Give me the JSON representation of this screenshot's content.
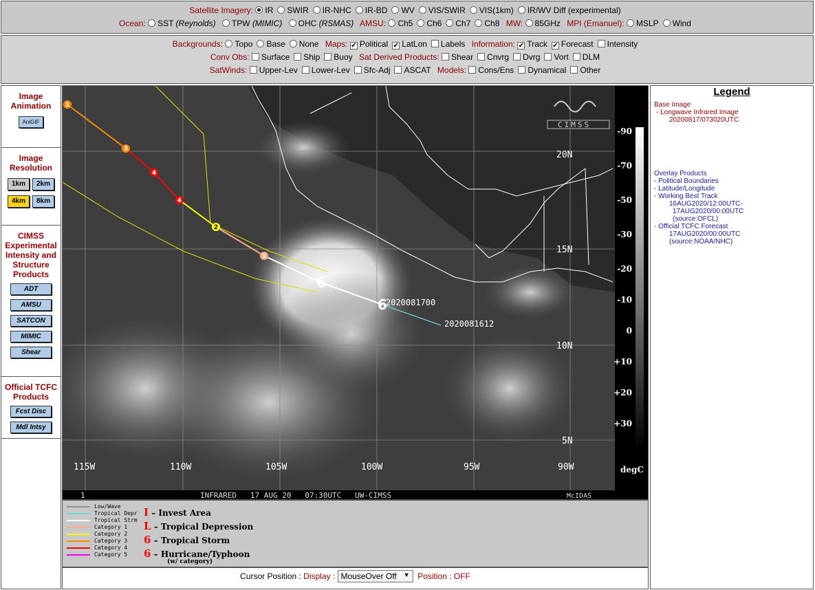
{
  "top1": {
    "row1_label": "Satellite Imagery:",
    "row1_options": [
      {
        "label": "IR",
        "checked": true
      },
      {
        "label": "SWIR",
        "checked": false
      },
      {
        "label": "IR-NHC",
        "checked": false
      },
      {
        "label": "IR-BD",
        "checked": false
      },
      {
        "label": "WV",
        "checked": false
      },
      {
        "label": "VIS/SWIR",
        "checked": false
      },
      {
        "label": "VIS(1km)",
        "checked": false
      },
      {
        "label": "IR/WV Diff (experimental)",
        "checked": false
      }
    ],
    "ocean_label": "Ocean:",
    "sst": "SST",
    "sst_src": "(Reynolds)",
    "tpw": "TPW",
    "tpw_src": "(MIMIC)",
    "ohc": "OHC",
    "ohc_src": "(RSMAS)",
    "amsu_label": "AMSU:",
    "amsu_opts": [
      "Ch5",
      "Ch6",
      "Ch7",
      "Ch8"
    ],
    "mw_label": "MW:",
    "mw_opt": "85GHz",
    "mpi_label": "MPI (Emanuel):",
    "mpi_opts": [
      "MSLP",
      "Wind"
    ]
  },
  "top2": {
    "bg_label": "Backgrounds:",
    "bg_opts": [
      "Topo",
      "Base",
      "None"
    ],
    "maps_label": "Maps:",
    "maps_opts": [
      {
        "label": "Political",
        "checked": true
      },
      {
        "label": "LatLon",
        "checked": true
      },
      {
        "label": "Labels",
        "checked": false
      }
    ],
    "info_label": "Information:",
    "info_opts": [
      {
        "label": "Track",
        "checked": true
      },
      {
        "label": "Forecast",
        "checked": true
      },
      {
        "label": "Intensity",
        "checked": false
      }
    ],
    "conv_label": "Conv Obs:",
    "conv_opts": [
      "Surface",
      "Ship",
      "Buoy"
    ],
    "sdp_label": "Sat Derived Products:",
    "sdp_opts": [
      "Shear",
      "Cnvrg",
      "Dvrg",
      "Vort",
      "DLM"
    ],
    "satwinds_label": "SatWinds:",
    "satwinds_opts": [
      "Upper-Lev",
      "Lower-Lev",
      "Sfc-Adj",
      "ASCAT"
    ],
    "models_label": "Models:",
    "models_opts": [
      "Cons/Ens",
      "Dynamical",
      "Other"
    ]
  },
  "sidebar": {
    "anim_title": "Image Animation",
    "anim_btn": "AniGIF",
    "res_title": "Image Resolution",
    "res_btns": [
      "1km",
      "2km",
      "4km",
      "8km"
    ],
    "cimss_title": "CIMSS Experimental Intensity and Structure Products",
    "cimss_btns": [
      "ADT",
      "AMSU",
      "SATCON",
      "MIMIC",
      "Shear"
    ],
    "tcfc_title": "Official TCFC Products",
    "tcfc_btns": [
      "Fcst Disc",
      "Mdl Intsy"
    ]
  },
  "colors": {
    "selected_res": "#ffd21a",
    "res_btn": "#c8c8c8",
    "side_btn": "#b0cce8",
    "label_red": "#8b0000",
    "legend_blue": "#1a1a8c"
  },
  "map": {
    "lat_labels": [
      "20N",
      "15N",
      "10N",
      "5N"
    ],
    "lon_labels": [
      "115W",
      "110W",
      "105W",
      "100W",
      "95W",
      "90W"
    ],
    "footer_num": "1",
    "footer_text": "INFRARED   17 AUG 20   07:30UTC   UW-CIMSS",
    "footer_right": "McIDAS",
    "stamp1": "2020081700",
    "stamp2": "2020081612",
    "logo": "CIMSS",
    "forecast_cats": [
      "1",
      "3",
      "4",
      "4",
      "2",
      "1"
    ]
  },
  "colorbar": {
    "ticks": [
      "-90",
      "-70",
      "-50",
      "-30",
      "-20",
      "-10",
      "0",
      "+10",
      "+20",
      "+30"
    ],
    "unit": "degC"
  },
  "legend": {
    "title": "Legend",
    "base_heading": "Base Image",
    "base_item": "-  Longwave Infrared Image",
    "base_time": "20200817/073020UTC",
    "overlay_heading": "Overlay Products",
    "overlay_items": [
      "-  Political Boundaries",
      "-  Latitude/Longitude",
      "-  Working Best Track"
    ],
    "best_track_time": "16AUG2020/12:00UTC-",
    "best_track_time2": "17AUG2020/00:00UTC",
    "best_track_src": "(source:OFCL)",
    "fcst_item": "-  Official TCFC Forecast",
    "fcst_time": "17AUG2020/00:00UTC",
    "fcst_src": "(source:NOAA/NHC)"
  },
  "key": {
    "lines": [
      {
        "label": "Low/Wave",
        "color": "#909090"
      },
      {
        "label": "Tropical Depr",
        "color": "#66dddd"
      },
      {
        "label": "Tropical Strm",
        "color": "#ffffff"
      },
      {
        "label": "Category 1",
        "color": "#ffaa88"
      },
      {
        "label": "Category 2",
        "color": "#ffff00"
      },
      {
        "label": "Category 3",
        "color": "#ff8800"
      },
      {
        "label": "Category 4",
        "color": "#ff0000"
      },
      {
        "label": "Category 5",
        "color": "#ff00ff"
      }
    ],
    "symbols": [
      "Invest Area",
      "Tropical Depression",
      "Tropical Storm",
      "Hurricane/Typhoon"
    ],
    "symbol_prefix": "– ",
    "wcat": "(w/ category)"
  },
  "cursor": {
    "label": "Cursor Position :",
    "display_label": "Display :",
    "display_value": "MouseOver Off",
    "pos_label": "Position :",
    "pos_value": "OFF"
  }
}
